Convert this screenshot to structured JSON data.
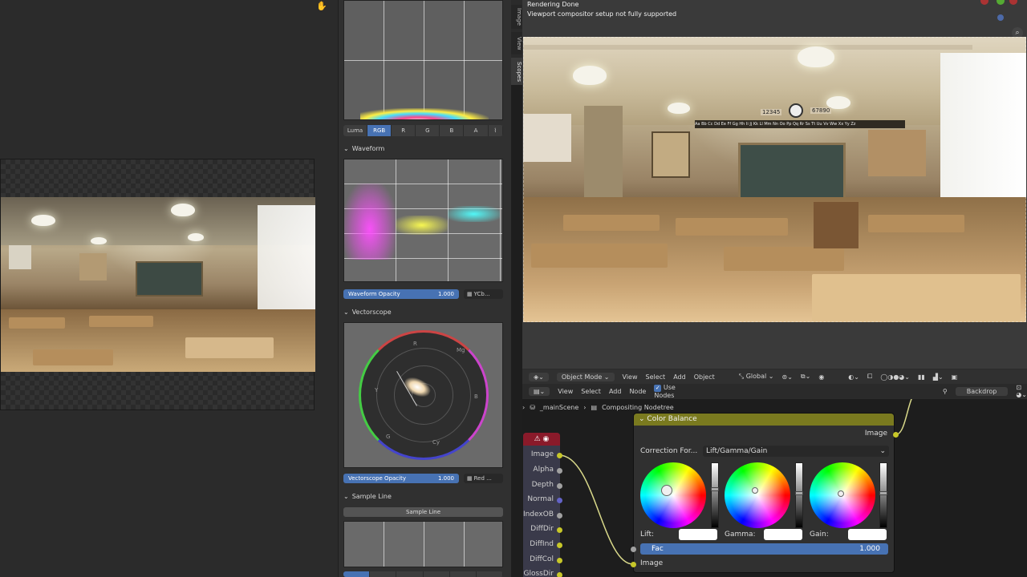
{
  "scopes": {
    "histogram_channels": [
      "Luma",
      "RGB",
      "R",
      "G",
      "B",
      "A"
    ],
    "histogram_active": "RGB",
    "waveform_title": "Waveform",
    "waveform_opacity_label": "Waveform Opacity",
    "waveform_opacity_value": "1.000",
    "waveform_mode": "YCb...",
    "vectorscope_title": "Vectorscope",
    "vectorscope_opacity_label": "Vectorscope Opacity",
    "vectorscope_opacity_value": "1.000",
    "vectorscope_mode": "Red ...",
    "sample_line_title": "Sample Line",
    "sample_line_button": "Sample Line",
    "vector_labels": [
      "R",
      "Mg",
      "B",
      "Cy",
      "G",
      "Y"
    ]
  },
  "side_tabs": [
    "Image",
    "View",
    "Scopes"
  ],
  "viewport": {
    "status_title": "Rendering Done",
    "status_message": "Viewport compositor setup not fully supported",
    "board_numbers_left": "12345",
    "board_numbers_right": "67890",
    "alphabet_strip": "Aa Bb Cc Dd Ee Ff Gg Hh Ii Jj Kk Ll Mm Nn Oo Pp Qq Rr Ss Tt Uu Vv Ww Xx Yy Zz"
  },
  "view3d_header": {
    "mode": "Object Mode",
    "menus": [
      "View",
      "Select",
      "Add",
      "Object"
    ],
    "transform": "Global"
  },
  "node_header": {
    "menus": [
      "View",
      "Select",
      "Add",
      "Node"
    ],
    "use_nodes_label": "Use Nodes",
    "backdrop_label": "Backdrop"
  },
  "breadcrumb": {
    "scene": "_mainScene",
    "tree": "Compositing Nodetree"
  },
  "render_layers_outputs": [
    "Image",
    "Alpha",
    "Depth",
    "Normal",
    "IndexOB",
    "DiffDir",
    "DiffInd",
    "DiffCol",
    "GlossDir"
  ],
  "color_balance": {
    "title": "Color Balance",
    "output_label": "Image",
    "correction_label": "Correction For...",
    "correction_value": "Lift/Gamma/Gain",
    "wheels": [
      {
        "label": "Lift:"
      },
      {
        "label": "Gamma:"
      },
      {
        "label": "Gain:"
      }
    ],
    "fac_label": "Fac",
    "fac_value": "1.000",
    "input_label": "Image"
  },
  "colors": {
    "accent": "#4772b3",
    "node_header_olive": "#7a7a1f",
    "render_layers_header": "#8a1a2a",
    "socket_yellow": "#c7c729"
  }
}
